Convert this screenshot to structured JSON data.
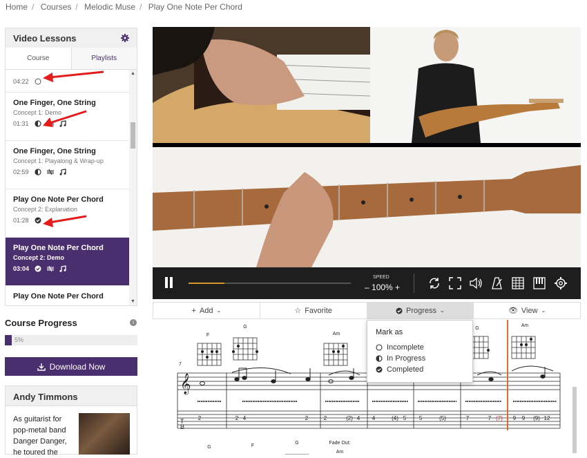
{
  "breadcrumb": [
    "Home",
    "Courses",
    "Melodic Muse",
    "Play One Note Per Chord"
  ],
  "sidebar": {
    "title": "Video Lessons",
    "tabs": {
      "course": "Course",
      "playlists": "Playlists"
    },
    "lessons": [
      {
        "title": "",
        "subtitle": "",
        "duration": "04:22",
        "status": "incomplete"
      },
      {
        "title": "One Finger, One String",
        "subtitle": "Concept 1: Demo",
        "duration": "01:31",
        "status": "in-progress"
      },
      {
        "title": "One Finger, One String",
        "subtitle": "Concept 1: Playalong & Wrap-up",
        "duration": "02:59",
        "status": "in-progress"
      },
      {
        "title": "Play One Note Per Chord",
        "subtitle": "Concept 2: Explanation",
        "duration": "01:28",
        "status": "completed"
      },
      {
        "title": "Play One Note Per Chord",
        "subtitle": "Concept 2: Demo",
        "duration": "03:04",
        "status": "completed",
        "active": true
      },
      {
        "title": "Play One Note Per Chord",
        "subtitle": "",
        "duration": "",
        "status": ""
      }
    ]
  },
  "course_progress": {
    "title": "Course Progress",
    "percent": 5,
    "label": "5%"
  },
  "download_label": "Download Now",
  "instructor": {
    "name": "Andy Timmons",
    "bio": "As guitarist for pop-metal band Danger Danger, he toured the"
  },
  "player": {
    "speed_label": "SPEED",
    "speed_value": "100%",
    "progress_fraction": 0.22
  },
  "toolbar": {
    "add": "Add",
    "favorite": "Favorite",
    "progress": "Progress",
    "view": "View"
  },
  "progress_menu": {
    "title": "Mark as",
    "items": [
      "Incomplete",
      "In Progress",
      "Completed"
    ]
  },
  "notation": {
    "chords_row1": [
      "F",
      "G",
      "Am",
      "G",
      "Am"
    ],
    "chords_row2": [
      "G",
      "F",
      "G",
      "Fade Out:",
      "Am"
    ],
    "measure_number": "7",
    "tab_numbers": [
      "2",
      "2",
      "4",
      "2",
      "2",
      "(2)",
      "4",
      "4",
      "(4)",
      "5",
      "5",
      "(5)",
      "7",
      "7",
      "(7)",
      "9",
      "9",
      "(9)",
      "12"
    ]
  },
  "colors": {
    "accent": "#4a2f6e",
    "annotation_red": "#e31b1b"
  }
}
